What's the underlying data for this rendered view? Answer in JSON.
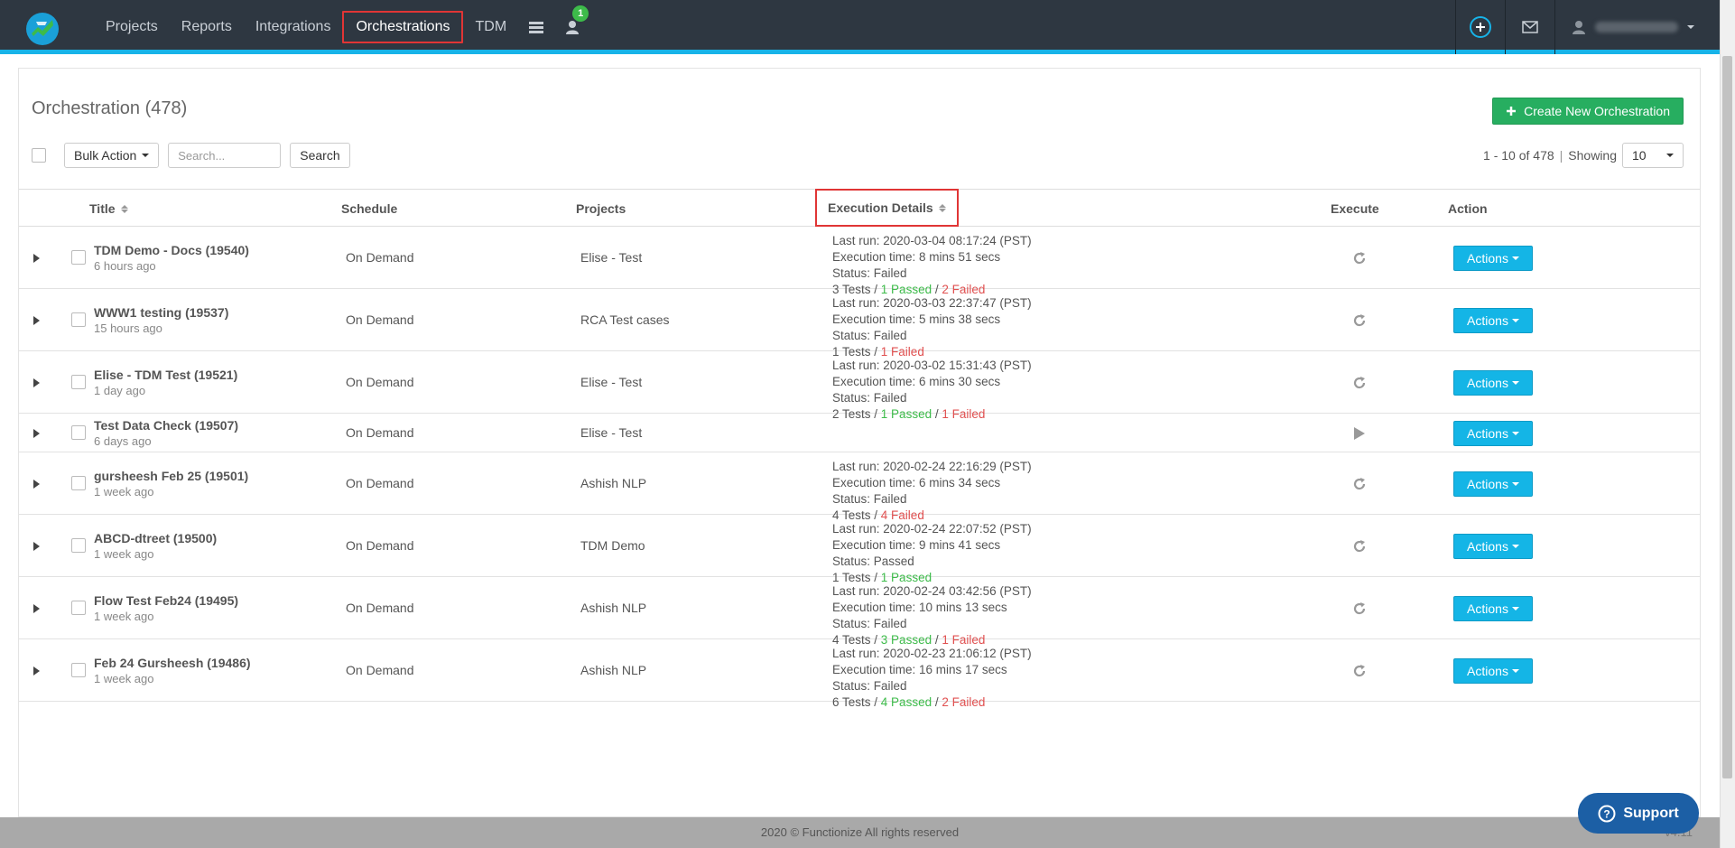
{
  "nav": {
    "items": [
      {
        "label": "Projects",
        "active": false
      },
      {
        "label": "Reports",
        "active": false
      },
      {
        "label": "Integrations",
        "active": false
      },
      {
        "label": "Orchestrations",
        "active": true
      },
      {
        "label": "TDM",
        "active": false
      }
    ],
    "notification_count": "1"
  },
  "header": {
    "title": "Orchestration (478)",
    "create_label": "Create New Orchestration"
  },
  "toolbar": {
    "bulk_action_label": "Bulk Action",
    "search_placeholder": "Search...",
    "search_button_label": "Search",
    "pager_text": "1 - 10 of 478",
    "showing_label": "Showing",
    "page_size": "10"
  },
  "columns": {
    "title": "Title",
    "schedule": "Schedule",
    "projects": "Projects",
    "execution_details": "Execution Details",
    "execute": "Execute",
    "action": "Action"
  },
  "rows": [
    {
      "title": "TDM Demo - Docs (19540)",
      "age": "6 hours ago",
      "schedule": "On Demand",
      "project": "Elise - Test",
      "last_run": "Last run: 2020-03-04 08:17:24 (PST)",
      "exec_time": "Execution time: 8 mins 51 secs",
      "status": "Status: Failed",
      "tests": "3 Tests",
      "passed": "1 Passed",
      "failed": "2 Failed",
      "exec_icon": "refresh-icon",
      "actions_label": "Actions"
    },
    {
      "title": "WWW1 testing (19537)",
      "age": "15 hours ago",
      "schedule": "On Demand",
      "project": "RCA Test cases",
      "last_run": "Last run: 2020-03-03 22:37:47 (PST)",
      "exec_time": "Execution time: 5 mins 38 secs",
      "status": "Status: Failed",
      "tests": "1 Tests",
      "passed": "",
      "failed": "1 Failed",
      "exec_icon": "refresh-icon",
      "actions_label": "Actions"
    },
    {
      "title": "Elise - TDM Test (19521)",
      "age": "1 day ago",
      "schedule": "On Demand",
      "project": "Elise - Test",
      "last_run": "Last run: 2020-03-02 15:31:43 (PST)",
      "exec_time": "Execution time: 6 mins 30 secs",
      "status": "Status: Failed",
      "tests": "2 Tests",
      "passed": "1 Passed",
      "failed": "1 Failed",
      "exec_icon": "refresh-icon",
      "actions_label": "Actions"
    },
    {
      "title": "Test Data Check (19507)",
      "age": "6 days ago",
      "schedule": "On Demand",
      "project": "Elise - Test",
      "last_run": "",
      "exec_time": "",
      "status": "",
      "tests": "",
      "passed": "",
      "failed": "",
      "exec_icon": "play-icon",
      "actions_label": "Actions"
    },
    {
      "title": "gursheesh Feb 25 (19501)",
      "age": "1 week ago",
      "schedule": "On Demand",
      "project": "Ashish NLP",
      "last_run": "Last run: 2020-02-24 22:16:29 (PST)",
      "exec_time": "Execution time: 6 mins 34 secs",
      "status": "Status: Failed",
      "tests": "4 Tests",
      "passed": "",
      "failed": "4 Failed",
      "exec_icon": "refresh-icon",
      "actions_label": "Actions"
    },
    {
      "title": "ABCD-dtreet (19500)",
      "age": "1 week ago",
      "schedule": "On Demand",
      "project": "TDM Demo",
      "last_run": "Last run: 2020-02-24 22:07:52 (PST)",
      "exec_time": "Execution time: 9 mins 41 secs",
      "status": "Status: Passed",
      "tests": "1 Tests",
      "passed": "1 Passed",
      "failed": "",
      "exec_icon": "refresh-icon",
      "actions_label": "Actions"
    },
    {
      "title": "Flow Test Feb24 (19495)",
      "age": "1 week ago",
      "schedule": "On Demand",
      "project": "Ashish NLP",
      "last_run": "Last run: 2020-02-24 03:42:56 (PST)",
      "exec_time": "Execution time: 10 mins 13 secs",
      "status": "Status: Failed",
      "tests": "4 Tests",
      "passed": "3 Passed",
      "failed": "1 Failed",
      "exec_icon": "refresh-icon",
      "actions_label": "Actions"
    },
    {
      "title": "Feb 24 Gursheesh (19486)",
      "age": "1 week ago",
      "schedule": "On Demand",
      "project": "Ashish NLP",
      "last_run": "Last run: 2020-02-23 21:06:12 (PST)",
      "exec_time": "Execution time: 16 mins 17 secs",
      "status": "Status: Failed",
      "tests": "6 Tests",
      "passed": "4 Passed",
      "failed": "2 Failed",
      "exec_icon": "refresh-icon",
      "actions_label": "Actions"
    }
  ],
  "footer": {
    "copyright": "2020 © Functionize All rights reserved",
    "version": "v4.11"
  },
  "support": {
    "label": "Support"
  },
  "colors": {
    "topbar": "#2e3741",
    "accent": "#17b3e8",
    "create_button": "#27ae60",
    "actions_button": "#14b5e6",
    "passed": "#3dbb4a",
    "failed": "#e05050",
    "highlight_box": "#e03535",
    "support_button": "#1c5fa5"
  }
}
